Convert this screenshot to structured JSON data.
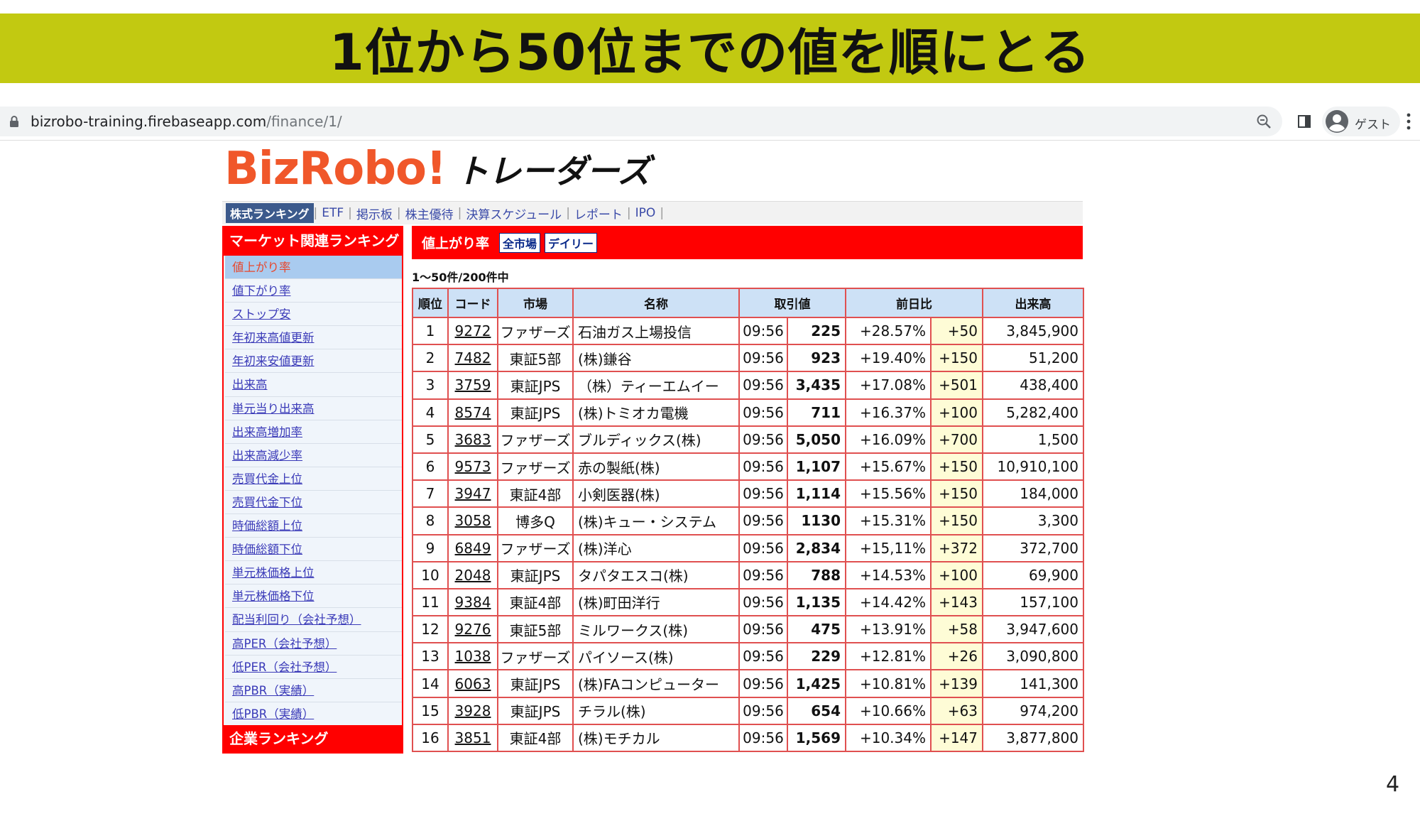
{
  "banner": {
    "title": "1位から50位までの値を順にとる"
  },
  "browser": {
    "url_host": "bizrobo-training.firebaseapp.com",
    "url_path": "/finance/1/",
    "profile_label": "ゲスト"
  },
  "logo": {
    "main": "BizRobo!",
    "sub": "トレーダーズ"
  },
  "nav": {
    "active": "株式ランキング",
    "items": [
      "ETF",
      "掲示板",
      "株主優待",
      "決算スケジュール",
      "レポート",
      "IPO"
    ]
  },
  "sidebar": {
    "header": "マーケット関連ランキング",
    "items": [
      "値上がり率",
      "値下がり率",
      "ストップ安",
      "年初来高値更新",
      "年初来安値更新",
      "出来高",
      "単元当り出来高",
      "出来高増加率",
      "出来高減少率",
      "売買代金上位",
      "売買代金下位",
      "時価総額上位",
      "時価総額下位",
      "単元株価格上位",
      "単元株価格下位",
      "配当利回り（会社予想）",
      "高PER（会社予想）",
      "低PER（会社予想）",
      "高PBR（実績）",
      "低PBR（実績）"
    ],
    "footer": "企業ランキング"
  },
  "main": {
    "title": "値上がり率",
    "badges": [
      "全市場",
      "デイリー"
    ],
    "count_text": "1～50件/200件中",
    "columns": [
      "順位",
      "コード",
      "市場",
      "名称",
      "取引値",
      "前日比",
      "出来高"
    ],
    "rows": [
      {
        "rank": "1",
        "code": "9272",
        "market": "ファザーズ",
        "name": "石油ガス上場投信",
        "time": "09:56",
        "price": "225",
        "pct": "+28.57%",
        "diff": "+50",
        "volume": "3,845,900"
      },
      {
        "rank": "2",
        "code": "7482",
        "market": "東証5部",
        "name": "(株)鎌谷",
        "time": "09:56",
        "price": "923",
        "pct": "+19.40%",
        "diff": "+150",
        "volume": "51,200"
      },
      {
        "rank": "3",
        "code": "3759",
        "market": "東証JPS",
        "name": "（株）ティーエムイー",
        "time": "09:56",
        "price": "3,435",
        "pct": "+17.08%",
        "diff": "+501",
        "volume": "438,400"
      },
      {
        "rank": "4",
        "code": "8574",
        "market": "東証JPS",
        "name": "(株)トミオカ電機",
        "time": "09:56",
        "price": "711",
        "pct": "+16.37%",
        "diff": "+100",
        "volume": "5,282,400"
      },
      {
        "rank": "5",
        "code": "3683",
        "market": "ファザーズ",
        "name": "ブルディックス(株)",
        "time": "09:56",
        "price": "5,050",
        "pct": "+16.09%",
        "diff": "+700",
        "volume": "1,500"
      },
      {
        "rank": "6",
        "code": "9573",
        "market": "ファザーズ",
        "name": "赤の製紙(株)",
        "time": "09:56",
        "price": "1,107",
        "pct": "+15.67%",
        "diff": "+150",
        "volume": "10,910,100"
      },
      {
        "rank": "7",
        "code": "3947",
        "market": "東証4部",
        "name": "小剣医器(株)",
        "time": "09:56",
        "price": "1,114",
        "pct": "+15.56%",
        "diff": "+150",
        "volume": "184,000"
      },
      {
        "rank": "8",
        "code": "3058",
        "market": "博多Q",
        "name": "(株)キュー・システム",
        "time": "09:56",
        "price": "1130",
        "pct": "+15.31%",
        "diff": "+150",
        "volume": "3,300"
      },
      {
        "rank": "9",
        "code": "6849",
        "market": "ファザーズ",
        "name": "(株)洋心",
        "time": "09:56",
        "price": "2,834",
        "pct": "+15,11%",
        "diff": "+372",
        "volume": "372,700"
      },
      {
        "rank": "10",
        "code": "2048",
        "market": "東証JPS",
        "name": "タパタエスコ(株)",
        "time": "09:56",
        "price": "788",
        "pct": "+14.53%",
        "diff": "+100",
        "volume": "69,900"
      },
      {
        "rank": "11",
        "code": "9384",
        "market": "東証4部",
        "name": "(株)町田洋行",
        "time": "09:56",
        "price": "1,135",
        "pct": "+14.42%",
        "diff": "+143",
        "volume": "157,100"
      },
      {
        "rank": "12",
        "code": "9276",
        "market": "東証5部",
        "name": "ミルワークス(株)",
        "time": "09:56",
        "price": "475",
        "pct": "+13.91%",
        "diff": "+58",
        "volume": "3,947,600"
      },
      {
        "rank": "13",
        "code": "1038",
        "market": "ファザーズ",
        "name": "パイソース(株)",
        "time": "09:56",
        "price": "229",
        "pct": "+12.81%",
        "diff": "+26",
        "volume": "3,090,800"
      },
      {
        "rank": "14",
        "code": "6063",
        "market": "東証JPS",
        "name": "(株)FAコンピューター",
        "time": "09:56",
        "price": "1,425",
        "pct": "+10.81%",
        "diff": "+139",
        "volume": "141,300"
      },
      {
        "rank": "15",
        "code": "3928",
        "market": "東証JPS",
        "name": "チラル(株)",
        "time": "09:56",
        "price": "654",
        "pct": "+10.66%",
        "diff": "+63",
        "volume": "974,200"
      },
      {
        "rank": "16",
        "code": "3851",
        "market": "東証4部",
        "name": "(株)モチカル",
        "time": "09:56",
        "price": "1,569",
        "pct": "+10.34%",
        "diff": "+147",
        "volume": "3,877,800"
      }
    ]
  },
  "page_number": "4",
  "colors": {
    "banner": "#c2c911",
    "accent_red": "#ff0000",
    "logo_orange": "#f0572a",
    "header_blue": "#cde1f6"
  }
}
